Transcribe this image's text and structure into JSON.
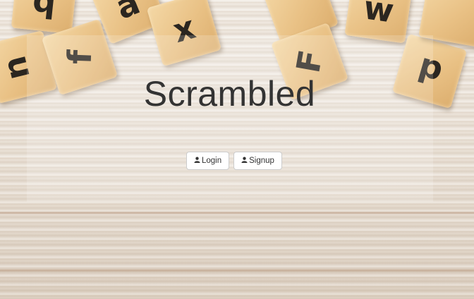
{
  "page": {
    "title": "Scrambled"
  },
  "actions": {
    "login_label": "Login",
    "signup_label": "Signup",
    "login_icon": "user-icon",
    "signup_icon": "user-icon"
  },
  "background": {
    "tiles": [
      "u",
      "f",
      "a",
      "x",
      "F",
      "w",
      "d",
      "q"
    ]
  },
  "colors": {
    "title": "#333333",
    "button_bg": "#ffffff",
    "button_border": "#cccccc"
  }
}
